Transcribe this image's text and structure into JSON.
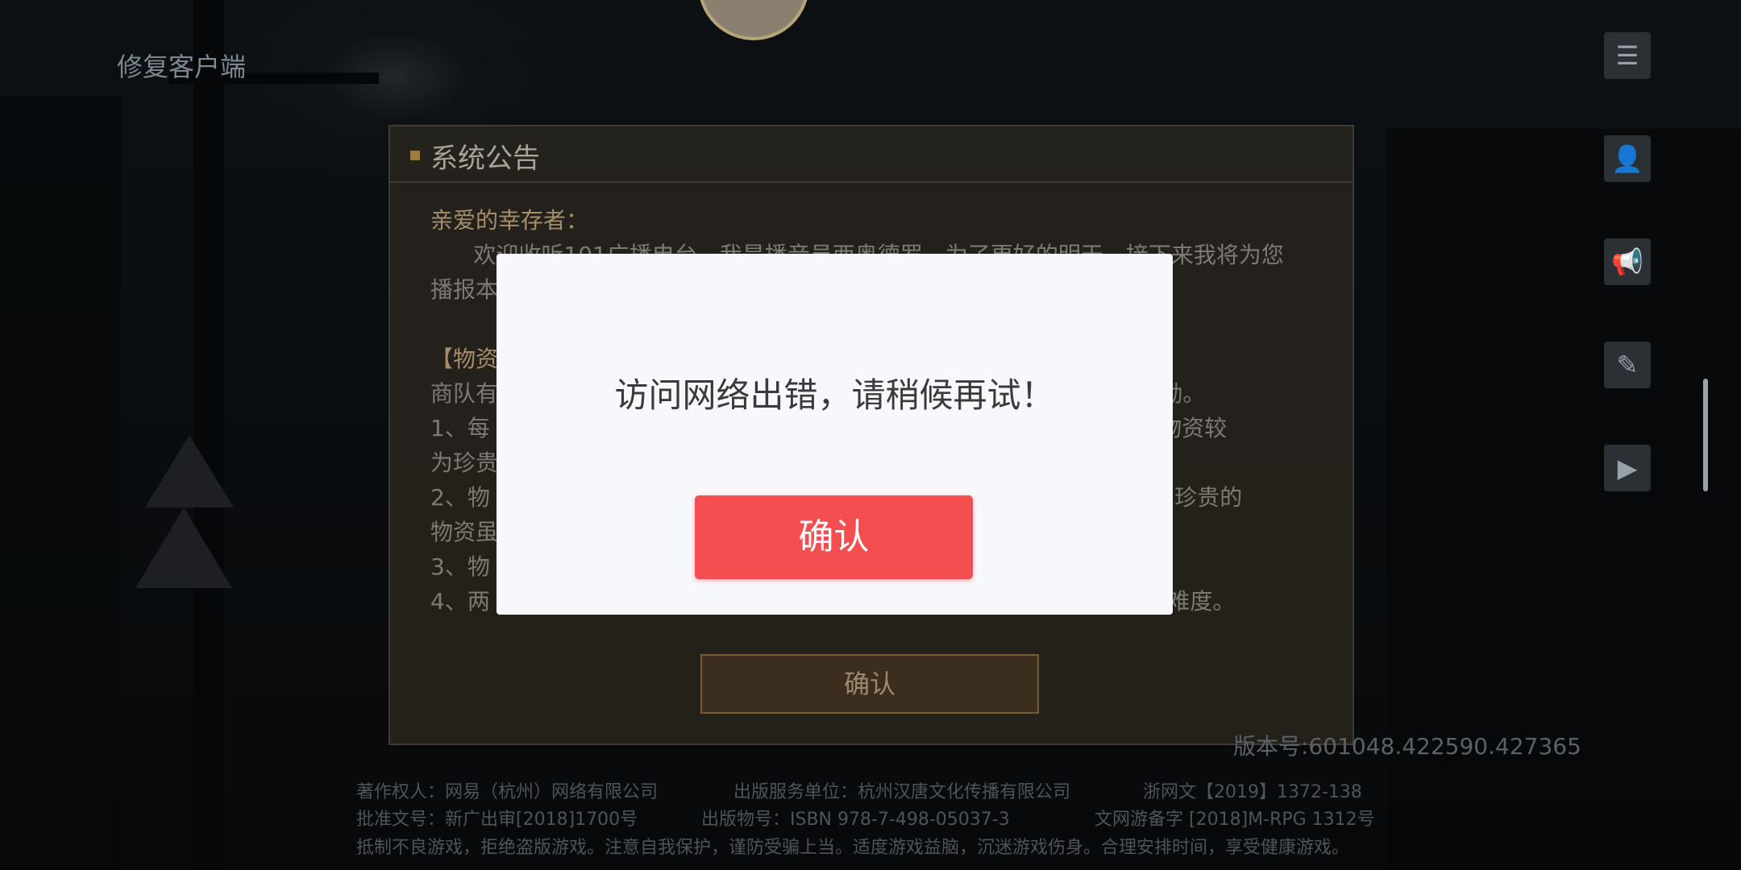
{
  "top_left": {
    "repair_label": "修复客户端"
  },
  "side_icons": [
    "notebook-icon",
    "user-icon",
    "megaphone-icon",
    "clipboard-icon",
    "video-icon"
  ],
  "notice": {
    "title": "系统公告",
    "lines": [
      {
        "text": "亲爱的幸存者：",
        "class": "gold"
      },
      {
        "text": "      欢迎收听101广播电台，我是播音员西奥德罗，为了更好的明天，接下来我将为您",
        "class": "gray"
      },
      {
        "text": "播报本",
        "class": "gray"
      },
      {
        "text": "",
        "class": "gray"
      },
      {
        "text": "【物资",
        "class": "gold"
      },
      {
        "text": "商队有                                                                                      厚奖励。",
        "class": "gray"
      },
      {
        "text": "1、每                                                                                       商队物资较",
        "class": "gray"
      },
      {
        "text": "为珍贵",
        "class": "gray"
      },
      {
        "text": "2、物                                                                                      物资。珍贵的",
        "class": "gray"
      },
      {
        "text": "物资虽                                                                                   。",
        "class": "gray"
      },
      {
        "text": "3、物",
        "class": "gray"
      },
      {
        "text": "4、两                                                                                     应怪物难度。",
        "class": "gray"
      }
    ],
    "confirm_label": "确认"
  },
  "version": "版本号:601048.422590.427365",
  "footer": {
    "row1": [
      "著作权人：网易（杭州）网络有限公司",
      "出版服务单位：杭州汉唐文化传播有限公司",
      "浙网文【2019】1372-138"
    ],
    "row2": [
      "批准文号：新广出审[2018]1700号",
      "出版物号：ISBN 978-7-498-05037-3",
      "文网游备字 [2018]M-RPG 1312号"
    ],
    "row3": "抵制不良游戏，拒绝盗版游戏。注意自我保护，谨防受骗上当。适度游戏益脑，沉迷游戏伤身。合理安排时间，享受健康游戏。"
  },
  "modal": {
    "message": "访问网络出错，请稍候再试！",
    "confirm_label": "确认"
  },
  "colors": {
    "modal_button": "#f54e51",
    "modal_bg": "#f7f8fb",
    "notice_accent": "#a07b3a"
  }
}
